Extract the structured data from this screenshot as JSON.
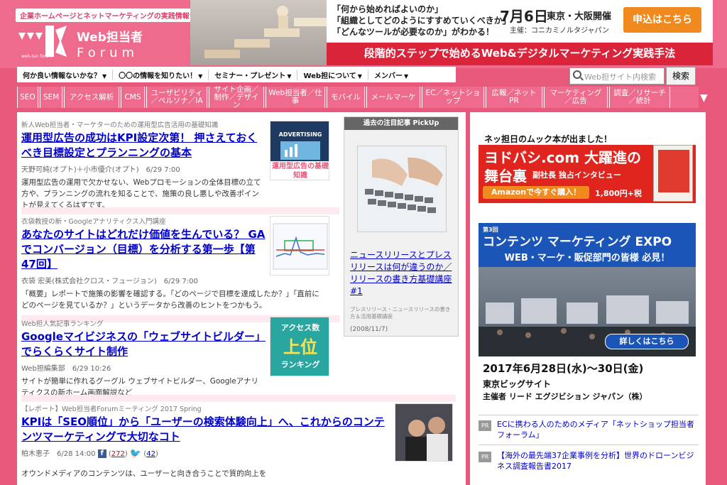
{
  "header": {
    "tagline": "企業ホームページとネットマーケティングの実践情報サイト",
    "logo_line1": "Web担当者",
    "logo_line2": "Forum",
    "logo_sub": "web-tan forum"
  },
  "top_ad": {
    "lines": [
      "「何から始めればよいのか」",
      "「組織としてどのようにすすめていくべきか」",
      "「どんなツールが必要なのか」がわかる！"
    ],
    "date": "7月6日",
    "place": "東京・大阪開催",
    "organizer": "主催：コニカミノルタジャパン",
    "button": "申込はこちら",
    "banner": "段階的ステップで始めるWeb&デジタルマーケティング実践手法"
  },
  "nav": {
    "items": [
      "何か良い情報ないかな？",
      "〇〇の情報を知りたい！",
      "セミナー・プレゼント",
      "Web担について",
      "メンバー"
    ]
  },
  "search": {
    "placeholder": "Web担サイト内検索",
    "button": "検索"
  },
  "categories": [
    "SEO",
    "SEM",
    "アクセス解析",
    "CMS",
    "ユーザビリティ／ペルソナ／IA",
    "サイト企画／制作／デザイン",
    "Web担当者／仕事",
    "モバイル",
    "メールマーケ",
    "EC／ネットショップ",
    "広報／ネットPR",
    "マーケティング／広告",
    "調査／リサーチ／統計"
  ],
  "articles": [
    {
      "kicker": "新人Web担当者・マーケターのための運用型広告活用の基礎知識",
      "title": "運用型広告の成功はKPI設定次第！ 押さえておくべき目標設定とプランニングの基本",
      "meta": "天野可純(オプト)＋小市優介(オプト)　6/29 7:00",
      "body": "運用型広告の運用で欠かせない、Webプロモーションの全体目標の立て方や、プランニングの流れを知ることで、施策の良し悪しや改善ポイントが見えてくるはずです。",
      "thumb_label": "ADVERTISING",
      "thumb_caption": "運用型広告の基礎知識"
    },
    {
      "kicker": "衣袋教授の新・Googleアナリティクス入門講座",
      "title": "あなたのサイトはどれだけ価値を生んでいる？ GAでコンバージョン（目標）を分析する第一歩【第47回】",
      "meta": "衣袋 宏美(株式会社クロス・フュージョン)　6/29 7:00",
      "body": "「概要」レポートで施策の影響を確認する。「どのページで目標を達成したか？」「直前にどのページを見ているか？」というデータから改善のヒントをつかもう。"
    },
    {
      "kicker": "Web担人気記事ランキング",
      "title": "Googleマイビジネスの「ウェブサイトビルダー」でらくらくサイト制作",
      "meta": "Web担編集部　6/29 10:26",
      "body": "サイトが簡単に作れるグーグル ウェブサイトビルダー、Googleアナリティクスの新ホーム画面解説など",
      "thumb_label1": "アクセス数",
      "thumb_label2": "上位",
      "thumb_label3": "ランキング"
    },
    {
      "kicker": "【レポート】Web担当者Forumミーティング 2017 Spring",
      "title": "KPIは「SEO順位」から「ユーザーの検索体験向上」へ、これからのコンテンツマーケティングで大切なコト",
      "meta": "柏木恵子　6/28 14:00",
      "fb_count": "272",
      "tw_count": "42",
      "body": "オウンドメディアのコンテンツは、ユーザーと向き合うことで質的向上を"
    }
  ],
  "pickup": {
    "header": "過去の注目記事 PickUp",
    "title": "ニュースリリースとプレスリリースは何が違うのか／リリースの書き方基礎講座#1",
    "note": "プレスリリース・ニュースリリースの書き方＆活用基礎講座",
    "date": "(2008/11/7)"
  },
  "sidebar": {
    "banner1": {
      "l1": "ネッ担日のムック本が出ました！",
      "l2": "ヨドバシ.com 大躍進の",
      "l3": "舞台裏",
      "l3b": "副社長 独占インタビュー",
      "btn": "Amazonで今すぐ購入！",
      "price": "1,800円+税"
    },
    "banner2": {
      "edition": "第3回",
      "title": "コンテンツ マーケティング EXPO",
      "sub": "WEB・マーケ・販促部門の皆様 必見！",
      "detail": "詳しくはこちら",
      "date": "2017年6月28日(水)〜30日(金)",
      "venue": "東京ビッグサイト",
      "org": "主催者 リード エグジビション ジャパン（株）"
    },
    "pr": [
      {
        "tag": "PR",
        "text": "ECに携わる人のためのメディア「ネットショップ担当者フォーラム」"
      },
      {
        "tag": "PR",
        "text": "【海外の最先端37企業事例を分析】世界のドローンビジネス調査報告書2017"
      }
    ]
  },
  "colors": {
    "brand_pink": "#ee6b8d",
    "link_blue": "#0000cc",
    "ad_red": "#d9243a",
    "cta_orange": "#f08a1e"
  }
}
